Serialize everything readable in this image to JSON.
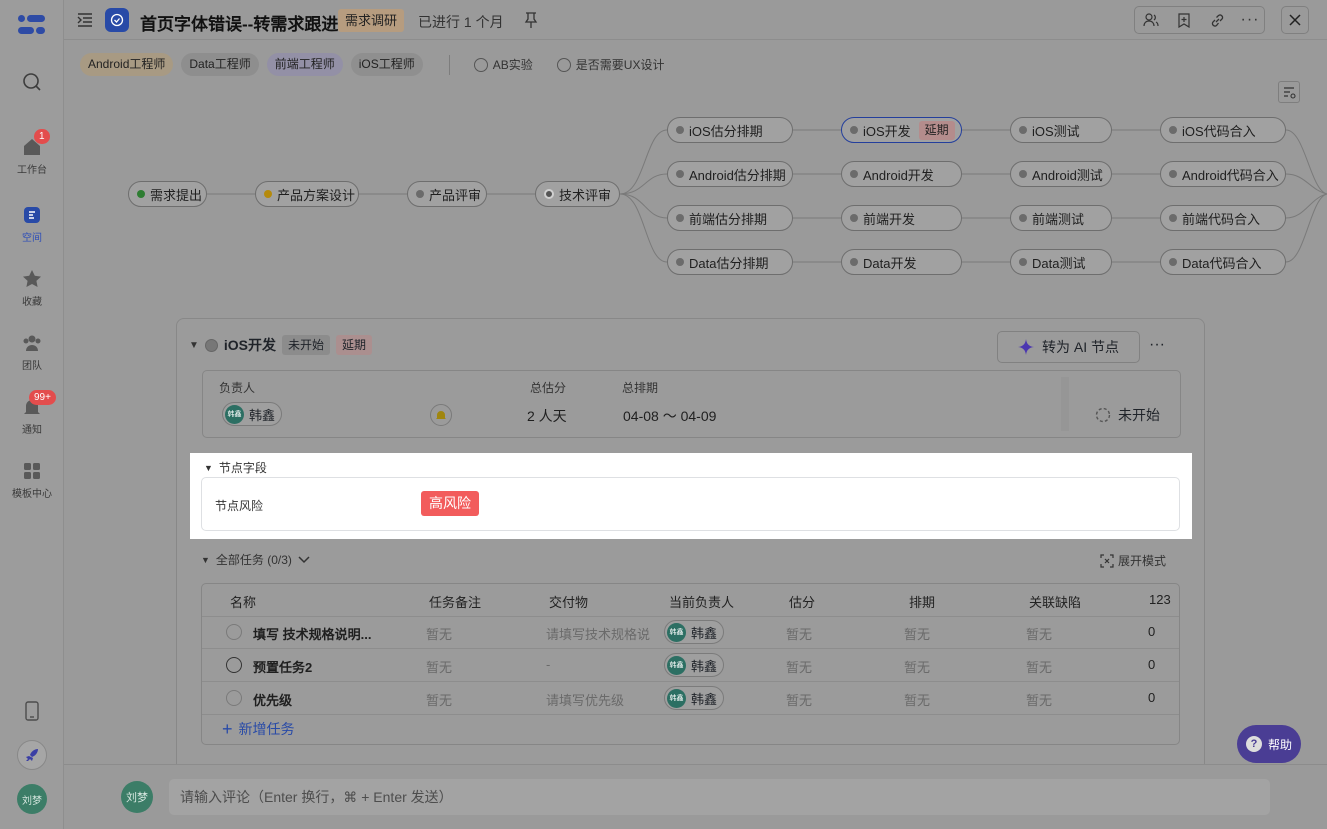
{
  "nav": {
    "items": [
      {
        "label": "",
        "icon": "search-icon"
      },
      {
        "label": "工作台",
        "icon": "home-icon",
        "badge": "1"
      },
      {
        "label": "空间",
        "icon": "space-icon"
      },
      {
        "label": "收藏",
        "icon": "star-icon"
      },
      {
        "label": "团队",
        "icon": "team-icon"
      },
      {
        "label": "通知",
        "icon": "bell-icon",
        "badge": "99+"
      },
      {
        "label": "模板中心",
        "icon": "template-icon"
      }
    ],
    "user_avatar": "刘梦"
  },
  "header": {
    "title": "首页字体错误--转需求跟进",
    "stage": "需求调研",
    "duration": "已进行 1 个月"
  },
  "roles": [
    "Android工程师",
    "Data工程师",
    "前端工程师",
    "iOS工程师"
  ],
  "options": [
    "AB实验",
    "是否需要UX设计"
  ],
  "flow": {
    "main": [
      "需求提出",
      "产品方案设计",
      "产品评审",
      "技术评审"
    ],
    "estimate": [
      "iOS估分排期",
      "Android估分排期",
      "前端估分排期",
      "Data估分排期"
    ],
    "dev": [
      "iOS开发",
      "Android开发",
      "前端开发",
      "Data开发"
    ],
    "test": [
      "iOS测试",
      "Android测试",
      "前端测试",
      "Data测试"
    ],
    "merge": [
      "iOS代码合入",
      "Android代码合入",
      "前端代码合入",
      "Data代码合入"
    ],
    "delay_tag": "延期"
  },
  "node": {
    "title": "iOS开发",
    "status": "未开始",
    "delay": "延期",
    "ai_button": "转为 AI 节点",
    "owner_label": "负责人",
    "owner": "韩鑫",
    "estimate_label": "总估分",
    "estimate": "2 人天",
    "schedule_label": "总排期",
    "schedule": "04-08 ～ 04-09",
    "state": "未开始"
  },
  "fields": {
    "section": "节点字段",
    "risk_label": "节点风险",
    "risk_value": "高风险"
  },
  "tasks": {
    "section": "全部任务 (0/3)",
    "expand": "展开模式",
    "columns": [
      "名称",
      "任务备注",
      "交付物",
      "当前负责人",
      "估分",
      "排期",
      "关联缺陷",
      "123"
    ],
    "rows": [
      {
        "name": "填写 技术规格说明...",
        "note": "暂无",
        "deliverable": "请填写技术规格说",
        "owner": "韩鑫",
        "estimate": "暂无",
        "schedule": "暂无",
        "bugs": "暂无",
        "num": "0"
      },
      {
        "name": "预置任务2",
        "note": "暂无",
        "deliverable": "-",
        "owner": "韩鑫",
        "estimate": "暂无",
        "schedule": "暂无",
        "bugs": "暂无",
        "num": "0"
      },
      {
        "name": "优先级",
        "note": "暂无",
        "deliverable": "请填写优先级",
        "owner": "韩鑫",
        "estimate": "暂无",
        "schedule": "暂无",
        "bugs": "暂无",
        "num": "0"
      }
    ],
    "add": "新增任务",
    "avatar_text": "韩鑫"
  },
  "help": "帮助",
  "comment": {
    "avatar": "刘梦",
    "placeholder": "请输入评论（Enter 换行，⌘ + Enter 发送）"
  },
  "colors": {
    "accent": "#284aa7",
    "risk": "#f25c5c",
    "help": "#4a3d94"
  }
}
